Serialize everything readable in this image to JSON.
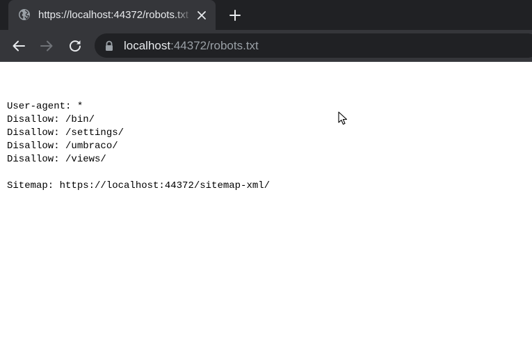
{
  "browser": {
    "tab": {
      "title": "https://localhost:44372/robots.txt",
      "favicon": "globe-icon"
    },
    "toolbar": {
      "back": "arrow-left-icon",
      "forward": "arrow-right-icon",
      "reload": "reload-icon",
      "url_host": "localhost",
      "url_rest": ":44372/robots.txt",
      "security": "lock-icon"
    },
    "colors": {
      "tabstrip_bg": "#202124",
      "tab_bg": "#35363a",
      "omnibox_bg": "#202124",
      "text_primary": "#e8eaed",
      "text_secondary": "#9aa0a6"
    }
  },
  "page": {
    "lines": [
      "User-agent: *",
      "Disallow: /bin/",
      "Disallow: /settings/",
      "Disallow: /umbraco/",
      "Disallow: /views/",
      "",
      "Sitemap: https://localhost:44372/sitemap-xml/"
    ]
  }
}
